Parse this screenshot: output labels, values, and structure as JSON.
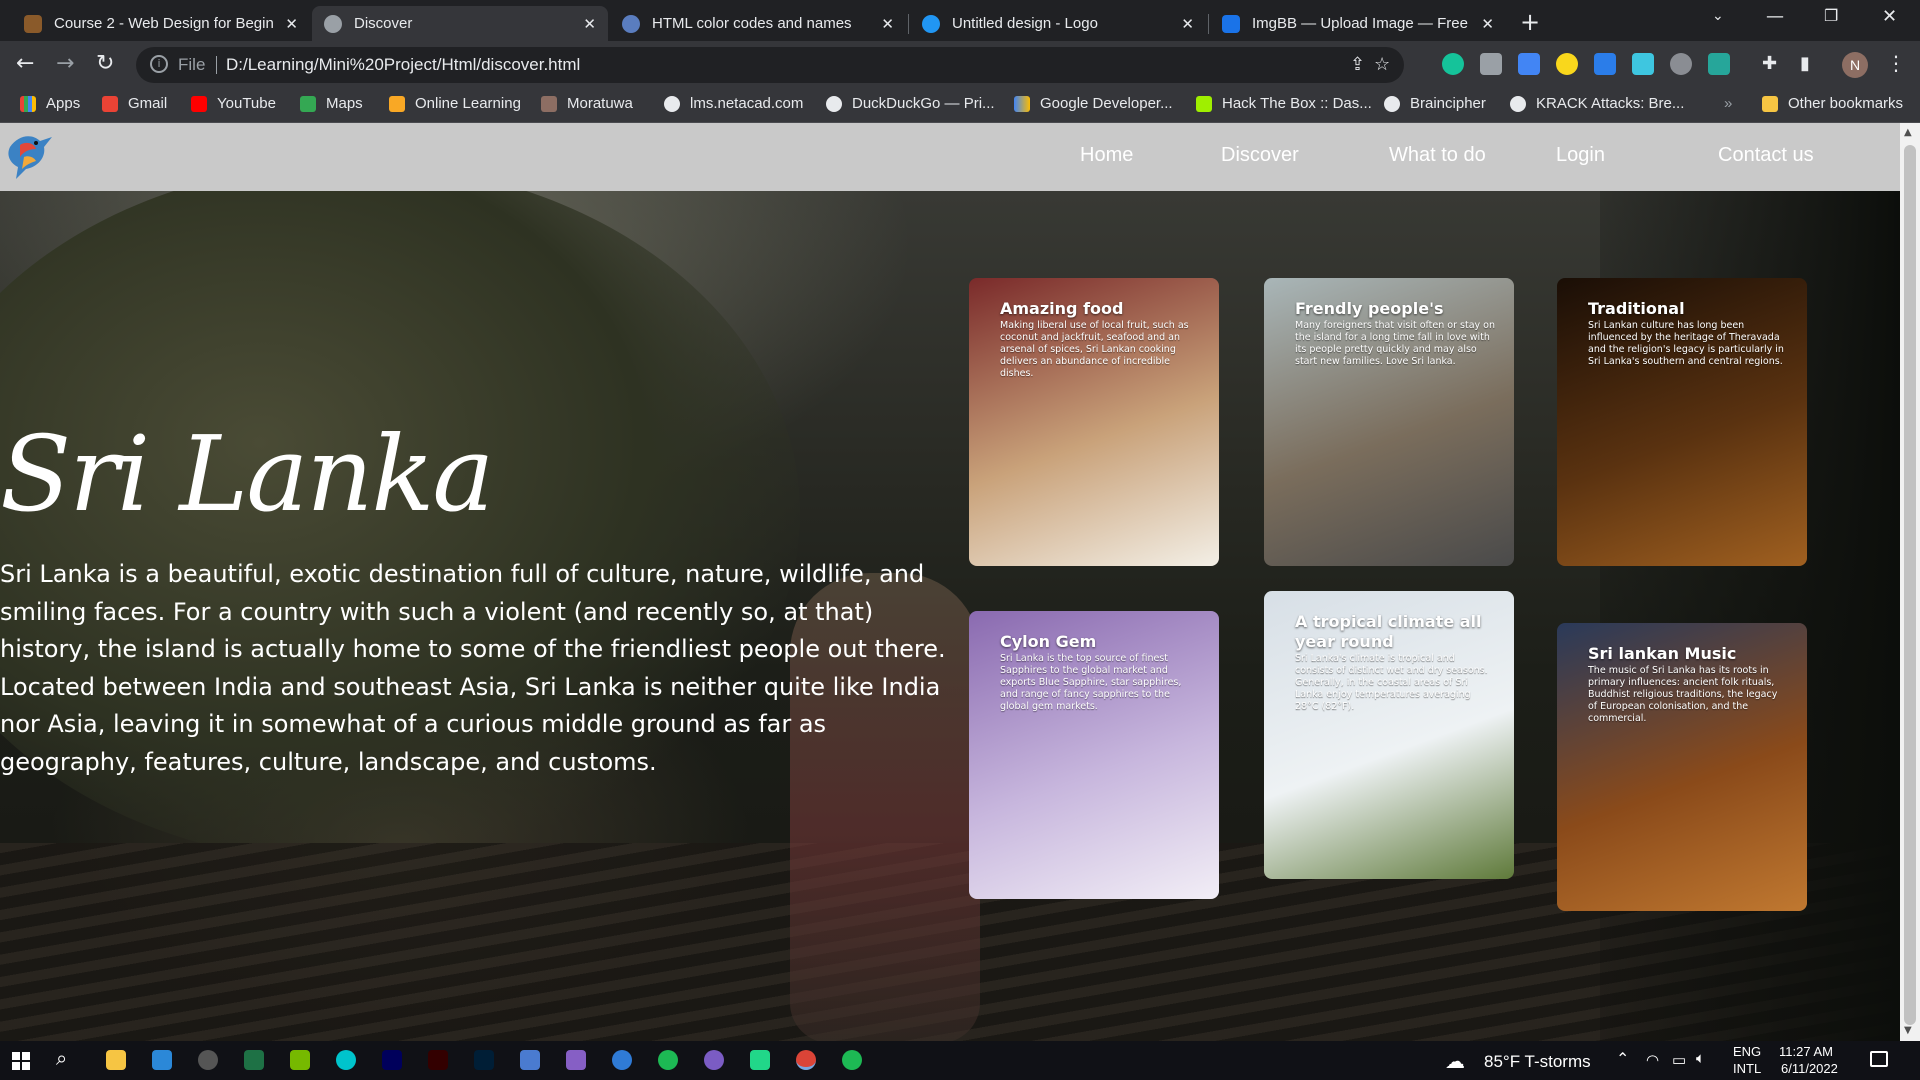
{
  "browser": {
    "tabs": [
      {
        "title": "Course 2 - Web Design for Begin",
        "favicon_color": "#8a5a2a",
        "active": false
      },
      {
        "title": "Discover",
        "favicon_color": "#9aa0a6",
        "active": true
      },
      {
        "title": "HTML color codes and names",
        "favicon_color": "#5a7dbf",
        "active": false
      },
      {
        "title": "Untitled design - Logo",
        "favicon_color": "#2196f3",
        "active": false
      },
      {
        "title": "ImgBB — Upload Image — Free",
        "favicon_color": "#1a73e8",
        "active": false
      }
    ],
    "address": {
      "scheme_label": "File",
      "url": "D:/Learning/Mini%20Project/Html/discover.html"
    },
    "bookmarks": [
      {
        "label": "Apps",
        "icon_color": "#ea4335"
      },
      {
        "label": "Gmail",
        "icon_color": "#ea4335"
      },
      {
        "label": "YouTube",
        "icon_color": "#ff0000"
      },
      {
        "label": "Maps",
        "icon_color": "#34a853"
      },
      {
        "label": "Online Learning",
        "icon_color": "#f9a825"
      },
      {
        "label": "Moratuwa",
        "icon_color": "#8d6e63"
      },
      {
        "label": "lms.netacad.com",
        "icon_color": "#e8eaed"
      },
      {
        "label": "DuckDuckGo — Pri...",
        "icon_color": "#e8eaed"
      },
      {
        "label": "Google Developer...",
        "icon_color": "#fbbc05"
      },
      {
        "label": "Hack The Box :: Das...",
        "icon_color": "#9fef00"
      },
      {
        "label": "Braincipher",
        "icon_color": "#e8eaed"
      },
      {
        "label": "KRACK Attacks: Bre...",
        "icon_color": "#e8eaed"
      }
    ],
    "more_bookmarks": "»",
    "other_bookmarks": "Other bookmarks",
    "profile_initial": "N"
  },
  "site": {
    "nav": [
      "Home",
      "Discover",
      "What to do",
      "Login",
      "Contact us"
    ],
    "hero": {
      "title": "Sri Lanka",
      "text": "Sri Lanka is a beautiful, exotic destination full of culture, nature, wildlife, and smiling faces. For a country with such a violent (and recently so, at that) history, the island is actually home to some of the friendliest people out there. Located between India and southeast Asia, Sri Lanka is neither quite like India nor Asia, leaving it in somewhat of a curious middle ground as far as geography, features, culture, landscape, and customs."
    },
    "cards": [
      {
        "title": "Amazing food",
        "text": "Making liberal use of local fruit, such as coconut and jackfruit, seafood and an arsenal of spices, Sri Lankan cooking delivers an abundance of incredible dishes.",
        "colors": [
          "#7a2a2a",
          "#c9a27a",
          "#f3efe6"
        ]
      },
      {
        "title": "Frendly people's",
        "text": "Many foreigners that visit often or stay on the island for a long time fall in love with its people pretty quickly and may also start new families. Love Sri lanka.",
        "colors": [
          "#a9b6b8",
          "#7a6d5c",
          "#4a4a4a"
        ]
      },
      {
        "title": "Traditional",
        "text": "Sri Lankan culture has long been influenced by the heritage of Theravada and the religion's legacy is particularly in Sri Lanka's southern and central regions.",
        "colors": [
          "#1a0e06",
          "#5a3210",
          "#a06020"
        ]
      },
      {
        "title": "Cylon Gem",
        "text": "Sri Lanka is the top source of finest Sapphires to the global market and exports Blue Sapphire, star sapphires, and range of fancy sapphires to the global gem markets.",
        "colors": [
          "#8a6ab0",
          "#c7b6dd",
          "#f2eef6"
        ]
      },
      {
        "title": "A tropical climate all year round",
        "text": "Sri Lanka's climate is tropical and consists of distinct wet and dry seasons. Generally, in the coastal areas of Sri Lanka enjoy temperatures averaging 28°C (82°F).",
        "colors": [
          "#d7dfe6",
          "#eef2f4",
          "#5f7a3a"
        ]
      },
      {
        "title": "Sri lankan Music",
        "text": "The music of Sri Lanka has its roots in primary influences: ancient folk rituals, Buddhist religious traditions, the legacy of European colonisation, and the commercial.",
        "colors": [
          "#2a3a5a",
          "#8a4a1a",
          "#c07830"
        ]
      }
    ]
  },
  "taskbar": {
    "weather": "85°F  T-storms",
    "lang_top": "ENG",
    "lang_bottom": "INTL",
    "time": "11:27 AM",
    "date": "6/11/2022"
  }
}
